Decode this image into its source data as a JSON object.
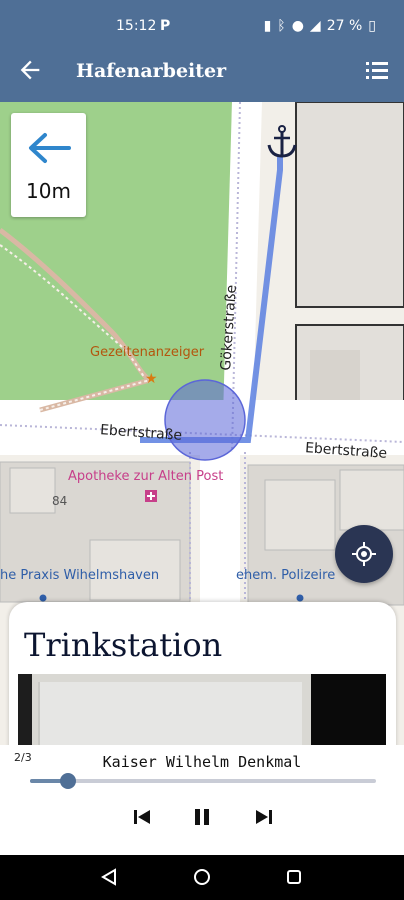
{
  "status_bar": {
    "time": "15:12",
    "battery": "27 %"
  },
  "app_bar": {
    "title": "Hafenarbeiter"
  },
  "map": {
    "streets": [
      "Gökerstraße",
      "Ebertstraße",
      "Ebertstraße"
    ],
    "pois": {
      "tide": "Gezeitenanzeiger",
      "pharmacy": "Apotheke zur Alten Post",
      "house_number": "84",
      "praxis": "he Praxis Wihelmshaven",
      "police": "ehem. Polizeire"
    }
  },
  "direction": {
    "distance": "10m"
  },
  "station": {
    "title": "Trinkstation"
  },
  "player": {
    "counter": "2/3",
    "track": "Kaiser Wilhelm Denkmal",
    "progress": 0.11
  },
  "colors": {
    "primary": "#4f6f96",
    "route": "#5a7fe0",
    "dark_button": "#2a3553"
  }
}
